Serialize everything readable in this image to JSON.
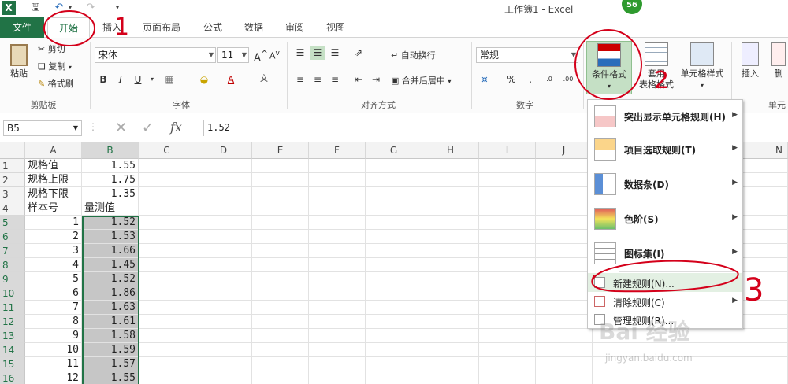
{
  "window_title": "工作簿1 - Excel",
  "badge": "56",
  "tabs": [
    {
      "label": "文件"
    },
    {
      "label": "开始"
    },
    {
      "label": "插入"
    },
    {
      "label": "页面布局"
    },
    {
      "label": "公式"
    },
    {
      "label": "数据"
    },
    {
      "label": "审阅"
    },
    {
      "label": "视图"
    }
  ],
  "ribbon": {
    "clipboard": {
      "paste": "粘贴",
      "cut": "剪切",
      "copy": "复制",
      "format_painter": "格式刷",
      "label": "剪贴板"
    },
    "font": {
      "name": "宋体",
      "size": "11",
      "label": "字体"
    },
    "alignment": {
      "wrap": "自动换行",
      "merge": "合并后居中",
      "label": "对齐方式"
    },
    "number": {
      "format": "常规",
      "label": "数字"
    },
    "styles": {
      "conditional": "条件格式",
      "table_line1": "套用",
      "table_line2": "表格格式",
      "cell_styles": "单元格样式"
    },
    "cells": {
      "insert": "插入",
      "delete": "删",
      "label": "单元"
    }
  },
  "formula_bar": {
    "name_box": "B5",
    "fx": "fx",
    "value": "1.52"
  },
  "columns": [
    "A",
    "B",
    "C",
    "D",
    "E",
    "F",
    "G",
    "H",
    "I",
    "J",
    "N"
  ],
  "rows": [
    {
      "n": "1",
      "a": "规格值",
      "b": "1.55"
    },
    {
      "n": "2",
      "a": "规格上限",
      "b": "1.75"
    },
    {
      "n": "3",
      "a": "规格下限",
      "b": "1.35"
    },
    {
      "n": "4",
      "a": "样本号",
      "b": "量测值"
    },
    {
      "n": "5",
      "a": "1",
      "b": "1.52"
    },
    {
      "n": "6",
      "a": "2",
      "b": "1.53"
    },
    {
      "n": "7",
      "a": "3",
      "b": "1.66"
    },
    {
      "n": "8",
      "a": "4",
      "b": "1.45"
    },
    {
      "n": "9",
      "a": "5",
      "b": "1.52"
    },
    {
      "n": "10",
      "a": "6",
      "b": "1.86"
    },
    {
      "n": "11",
      "a": "7",
      "b": "1.63"
    },
    {
      "n": "12",
      "a": "8",
      "b": "1.61"
    },
    {
      "n": "13",
      "a": "9",
      "b": "1.58"
    },
    {
      "n": "14",
      "a": "10",
      "b": "1.59"
    },
    {
      "n": "15",
      "a": "11",
      "b": "1.57"
    },
    {
      "n": "16",
      "a": "12",
      "b": "1.55"
    }
  ],
  "menu": {
    "highlight": "突出显示单元格规则(H)",
    "topbottom": "项目选取规则(T)",
    "databar": "数据条(D)",
    "colorscale": "色阶(S)",
    "iconset": "图标集(I)",
    "new_rule": "新建规则(N)...",
    "clear_rule": "清除规则(C)",
    "manage_rule": "管理规则(R)..."
  },
  "annotations": {
    "one": "1",
    "two": "2",
    "three": "3"
  },
  "watermark": {
    "brand": "Bai 经验",
    "url": "jingyan.baidu.com"
  },
  "colors": {
    "excel_green": "#217346",
    "selection": "#c6c6c6",
    "annotation_red": "#d4001a",
    "menu_highlight": "#e3f0e3"
  }
}
